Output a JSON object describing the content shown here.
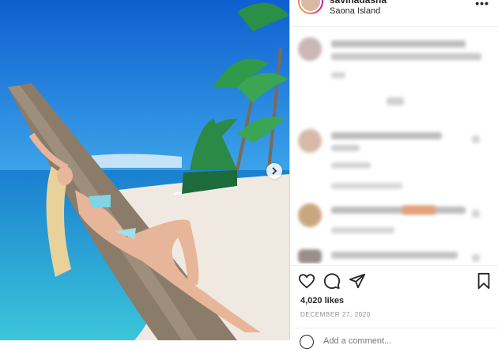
{
  "post": {
    "username": "savinadasha",
    "location": "Saona Island",
    "more_label": "•••",
    "likes": "4,020 likes",
    "date": "DECEMBER 27, 2020",
    "add_comment_placeholder": "Add a comment..."
  },
  "icons": {
    "heart": "heart-icon",
    "comment": "comment-icon",
    "share": "share-icon",
    "save": "bookmark-icon",
    "next": "chevron-right-icon",
    "emoji": "emoji-icon"
  },
  "colors": {
    "sky": "#1e78d8",
    "sea": "#1aa3c9",
    "sand": "#f2eee8",
    "text": "#262626",
    "muted": "#8e8e8e",
    "divider": "#efefef"
  }
}
